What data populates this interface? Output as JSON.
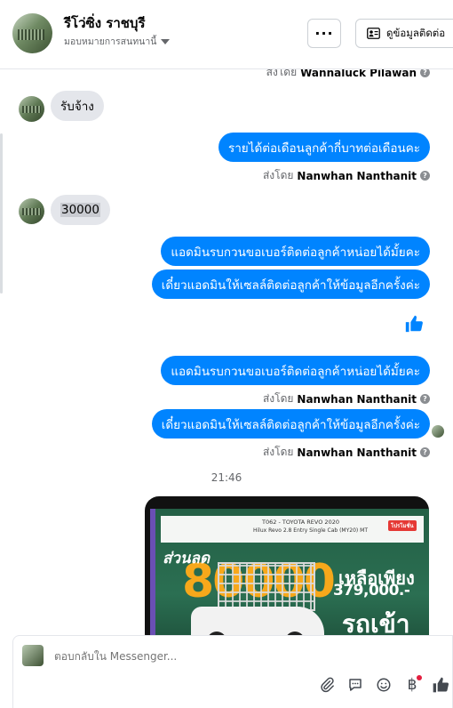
{
  "header": {
    "name": "รีโว่ซิ่ง ราชบุรี",
    "assign_label": "มอบหมายการสนทนานี้",
    "more_label": "···",
    "contact_label": "ดูข้อมูลติดต่อ"
  },
  "messages": {
    "sent_by_prefix": "ส่งโดย",
    "top_sender": "Wannaluck Pilawan",
    "in_1": "รับจ้าง",
    "out_1": "รายได้ต่อเดือนลูกค้ากี่บาทต่อเดือนคะ",
    "sender_1": "Nanwhan Nanthanit",
    "in_2": "30000",
    "out_2": "แอดมินรบกวนขอเบอร์ติดต่อลูกค้าหน่อยได้มั้ยคะ",
    "out_3": "เดี๋ยวแอดมินให้เซลล์ติดต่อลูกค้าให้ข้อมูลอีกครั้งค่ะ",
    "out_4": "แอดมินรบกวนขอเบอร์ติดต่อลูกค้าหน่อยได้มั้ยคะ",
    "sender_2": "Nanwhan Nanthanit",
    "out_5": "เดี๋ยวแอดมินให้เซลล์ติดต่อลูกค้าให้ข้อมูลอีกครั้งค่ะ",
    "sender_3": "Nanwhan Nanthanit",
    "time": "21:46"
  },
  "promo": {
    "line1": "T062 - TOYOTA REVO 2020",
    "line2": "Hilux Revo 2.8 Entry Single Cab (MY20) MT",
    "tag": "โปรโมชั่น",
    "sale": "ส่วนลด",
    "amount": "80000",
    "left": "เหลือเพียง",
    "price": "379,000.-",
    "car": "รถเข้า"
  },
  "composer": {
    "placeholder": "ตอบกลับใน Messenger..."
  },
  "icons": {
    "attach": "paperclip-icon",
    "reply": "chat-bubble-icon",
    "emoji": "smiley-icon",
    "baht": "baht-icon",
    "like": "thumbs-up-icon"
  },
  "colors": {
    "outgoing": "#0084ff",
    "incoming": "#e4e6eb",
    "like": "#0084ff"
  }
}
